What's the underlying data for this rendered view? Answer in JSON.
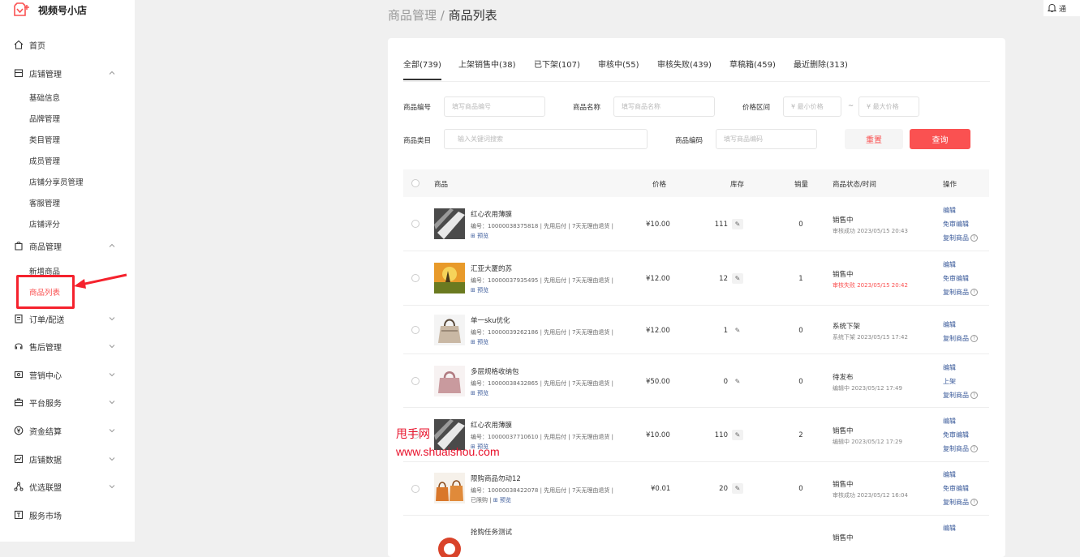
{
  "app": {
    "title": "视频号小店"
  },
  "sidebar": {
    "home": "首页",
    "store": {
      "label": "店铺管理",
      "items": [
        "基础信息",
        "品牌管理",
        "类目管理",
        "成员管理",
        "店铺分享员管理",
        "客服管理",
        "店铺评分"
      ]
    },
    "goods": {
      "label": "商品管理",
      "items": [
        "新增商品",
        "商品列表"
      ]
    },
    "orders": "订单/配送",
    "aftersale": "售后管理",
    "marketing": "营销中心",
    "platform": "平台服务",
    "finance": "资金结算",
    "data": "店铺数据",
    "alliance": "优选联盟",
    "market": "服务市场"
  },
  "breadcrumb": {
    "parent": "商品管理",
    "sep": "/",
    "current": "商品列表"
  },
  "notice": {
    "text": "通"
  },
  "tabs": [
    "全部(739)",
    "上架销售中(38)",
    "已下架(107)",
    "审核中(55)",
    "审核失败(439)",
    "草稿箱(459)",
    "最近删除(313)"
  ],
  "filters": {
    "code_label": "商品编号",
    "code_placeholder": "填写商品编号",
    "name_label": "商品名称",
    "name_placeholder": "填写商品名称",
    "price_label": "价格区间",
    "price_min_placeholder": "¥ 最小价格",
    "price_sep": "~",
    "price_max_placeholder": "¥ 最大价格",
    "category_label": "商品类目",
    "category_placeholder": "输入关键词搜索",
    "barcode_label": "商品编码",
    "barcode_placeholder": "填写商品编码",
    "reset": "重置",
    "query": "查询"
  },
  "table": {
    "headers": {
      "product": "商品",
      "price": "价格",
      "stock": "库存",
      "sales": "销量",
      "status": "商品状态/时间",
      "ops": "操作"
    },
    "edit_glyph": "✎",
    "rows": [
      {
        "name": "红心农用薄膜",
        "info": "编号：10000038375818 | 先用后付 | 7天无理由退货 |",
        "extra": "",
        "extra_link": "预览",
        "price": "¥10.00",
        "stock": "111",
        "sales": "0",
        "status": "销售中",
        "status_sub": "审核成功 2023/05/15 20:43",
        "status_sub_red": false,
        "ops": [
          "编辑",
          "免审编辑",
          "复制商品"
        ]
      },
      {
        "name": "汇亚大厦的苏",
        "info": "编号：10000037935495 | 先用后付 | 7天无理由退货 |",
        "extra": "",
        "extra_link": "预览",
        "price": "¥12.00",
        "stock": "12",
        "sales": "1",
        "status": "销售中",
        "status_sub": "审核失败 2023/05/15 20:42",
        "status_sub_red": true,
        "ops": [
          "编辑",
          "免审编辑",
          "复制商品"
        ]
      },
      {
        "name": "单一sku优化",
        "info": "编号：10000039262186 | 先用后付 | 7天无理由退货 |",
        "extra": "",
        "extra_link": "预览",
        "price": "¥12.00",
        "stock": "1",
        "sales": "0",
        "status": "系统下架",
        "status_sub": "系统下架 2023/05/15 17:42",
        "status_sub_red": false,
        "ops": [
          "编辑",
          "复制商品"
        ]
      },
      {
        "name": "多层规格收纳包",
        "info": "编号：10000038432865 | 先用后付 | 7天无理由退货 |",
        "extra": "",
        "extra_link": "预览",
        "price": "¥50.00",
        "stock": "0",
        "sales": "0",
        "status": "待发布",
        "status_sub": "编辑中 2023/05/12 17:49",
        "status_sub_red": false,
        "ops": [
          "编辑",
          "上架",
          "复制商品"
        ]
      },
      {
        "name": "红心农用薄膜",
        "info": "编号：10000037710610 | 先用后付 | 7天无理由退货 |",
        "extra": "",
        "extra_link": "预览",
        "price": "¥10.00",
        "stock": "110",
        "sales": "2",
        "status": "销售中",
        "status_sub": "编辑中 2023/05/12 17:29",
        "status_sub_red": false,
        "ops": [
          "编辑",
          "免审编辑",
          "复制商品"
        ]
      },
      {
        "name": "限购商品勿动12",
        "info": "编号：10000038422078 | 先用后付 | 7天无理由退货 |",
        "extra": "已限购 |",
        "extra_link": "预览",
        "price": "¥0.01",
        "stock": "20",
        "sales": "0",
        "status": "销售中",
        "status_sub": "审核成功 2023/05/12 16:04",
        "status_sub_red": false,
        "ops": [
          "编辑",
          "免审编辑",
          "复制商品"
        ]
      },
      {
        "name": "抢购任务测试",
        "info": "",
        "extra": "",
        "extra_link": "",
        "price": "",
        "stock": "",
        "sales": "",
        "status": "销售中",
        "status_sub": "",
        "status_sub_red": false,
        "ops": [
          "编辑"
        ]
      }
    ]
  },
  "watermark": {
    "line1": "甩手网",
    "line2": "www.shuaishou.com"
  },
  "colors": {
    "accent": "#fa5151",
    "link": "#3a5a9a",
    "highlight": "#f5222d"
  }
}
